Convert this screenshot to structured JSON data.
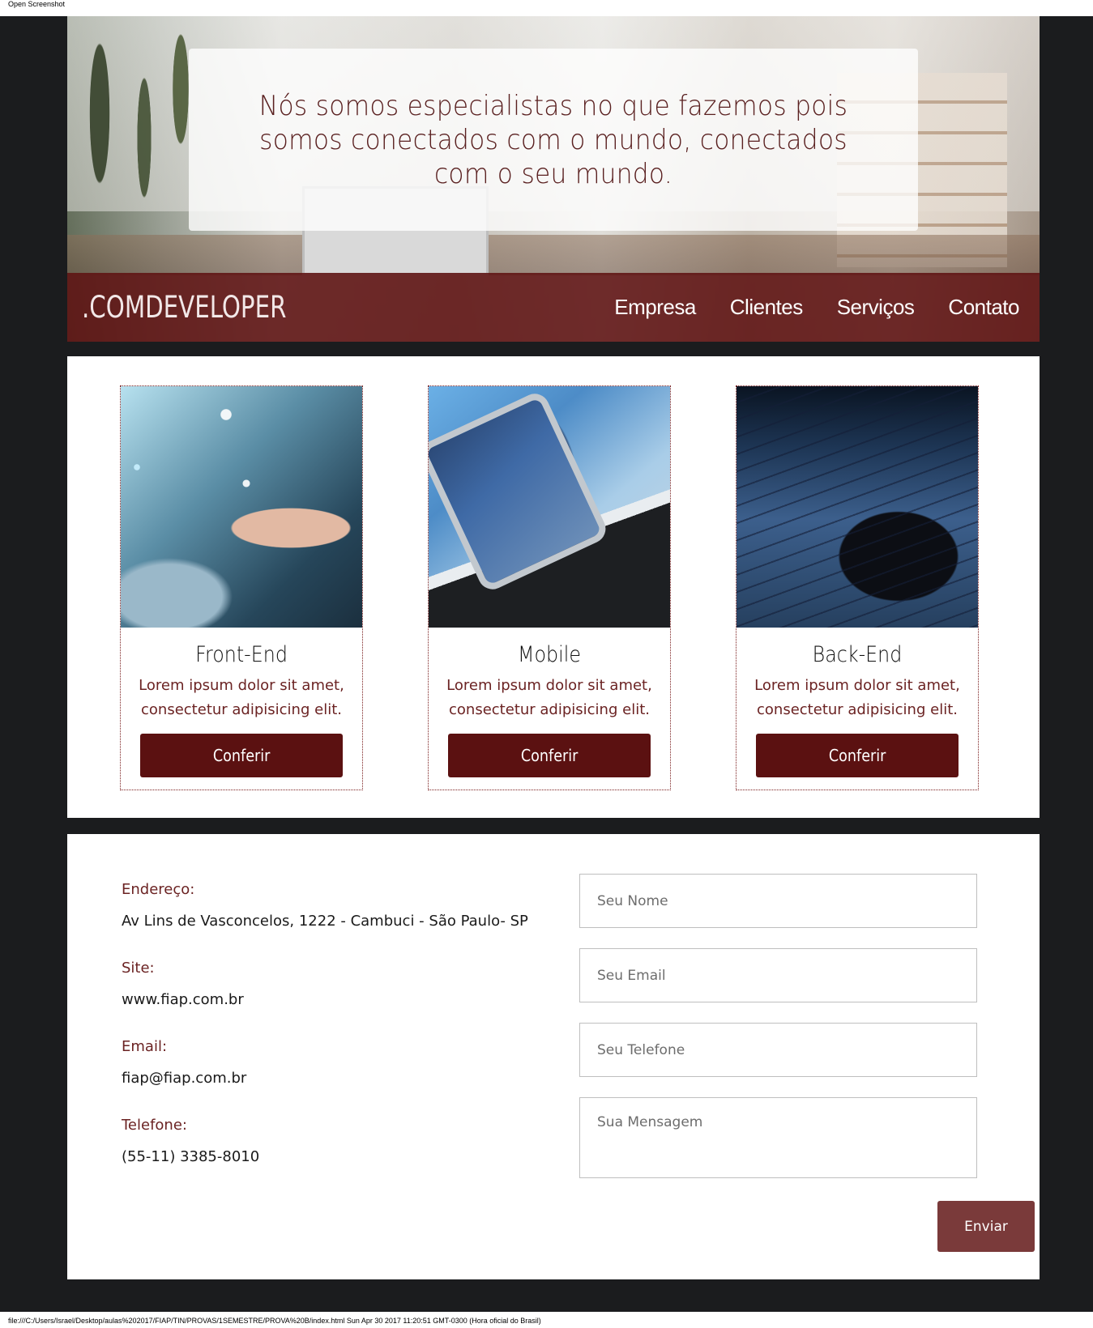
{
  "screenshot_label": "Open Screenshot",
  "footer_path": "file:///C:/Users/Israel/Desktop/aulas%202017/FIAP/TIN/PROVAS/1SEMESTRE/PROVA%20B/index.html Sun Apr 30 2017 11:20:51 GMT-0300 (Hora oficial do Brasil)",
  "hero": {
    "headline": "Nós somos especialistas no que fazemos pois somos conectados com o mundo, conectados com o seu mundo."
  },
  "header": {
    "logo": ".COMDEVELOPER",
    "nav": [
      "Empresa",
      "Clientes",
      "Serviços",
      "Contato"
    ]
  },
  "services": [
    {
      "title": "Front-End",
      "description": "Lorem ipsum dolor sit amet, consectetur adipisicing elit.",
      "button": "Conferir"
    },
    {
      "title": "Mobile",
      "description": "Lorem ipsum dolor sit amet, consectetur adipisicing elit.",
      "button": "Conferir"
    },
    {
      "title": "Back-End",
      "description": "Lorem ipsum dolor sit amet, consectetur adipisicing elit.",
      "button": "Conferir"
    }
  ],
  "contact": {
    "address_label": "Endereço:",
    "address_value": "Av Lins de Vasconcelos, 1222 - Cambuci - São Paulo- SP",
    "site_label": "Site:",
    "site_value": "www.fiap.com.br",
    "email_label": "Email:",
    "email_value": "fiap@fiap.com.br",
    "phone_label": "Telefone:",
    "phone_value": "(55-11) 3385-8010"
  },
  "form": {
    "name_placeholder": "Seu Nome",
    "email_placeholder": "Seu Email",
    "phone_placeholder": "Seu Telefone",
    "message_placeholder": "Sua Mensagem",
    "submit_label": "Enviar"
  },
  "colors": {
    "brand": "#5b1111",
    "accent_text": "#6b2323",
    "page_background": "#1b1c1e",
    "submit_button": "#7a3a3a"
  }
}
